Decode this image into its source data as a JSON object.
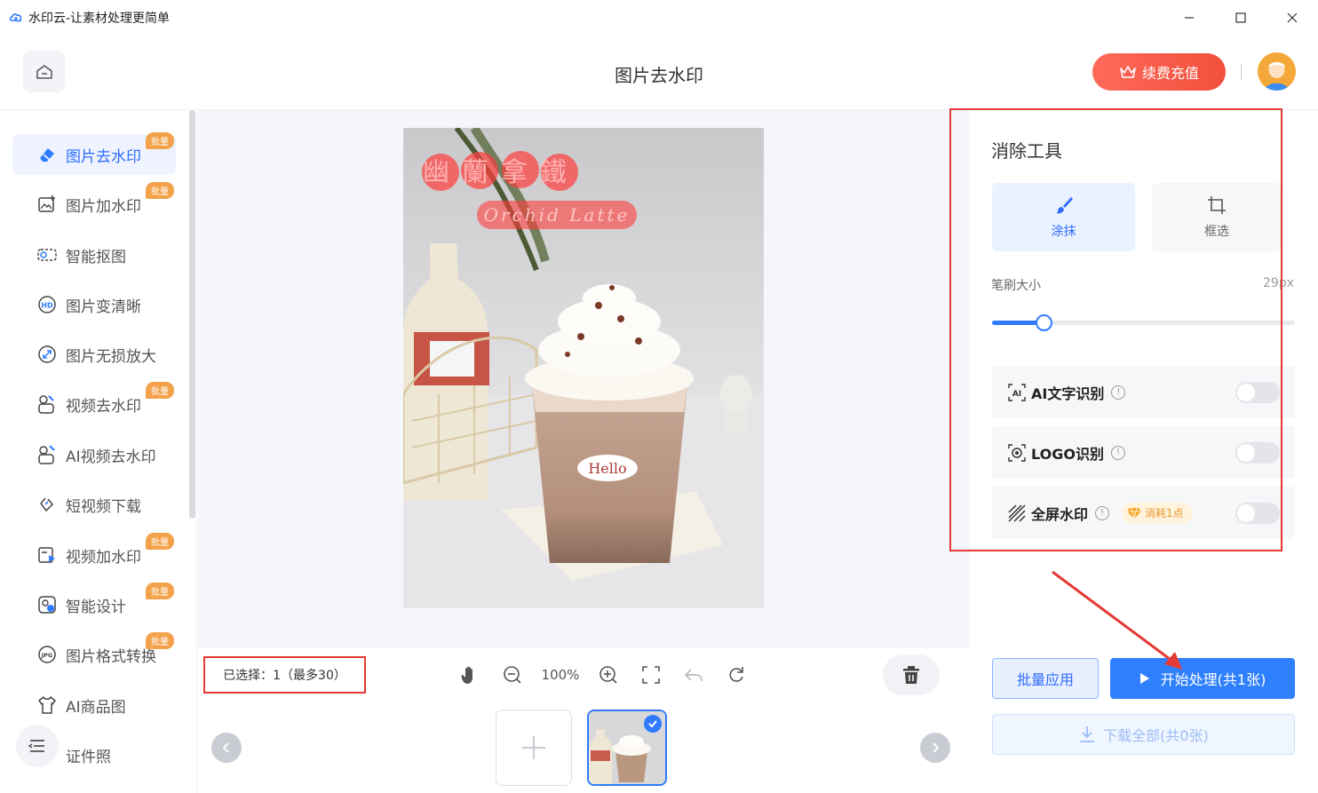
{
  "window": {
    "title": "水印云-让素材处理更简单"
  },
  "header": {
    "page_title": "图片去水印",
    "recharge_label": "续费充值"
  },
  "sidebar": {
    "items": [
      {
        "label": "图片去水印",
        "badge": "批量",
        "icon": "eraser-icon",
        "active": true
      },
      {
        "label": "图片加水印",
        "badge": "批量",
        "icon": "image-add-icon"
      },
      {
        "label": "智能抠图",
        "badge": "",
        "icon": "cutout-icon"
      },
      {
        "label": "图片变清晰",
        "badge": "",
        "icon": "hd-icon"
      },
      {
        "label": "图片无损放大",
        "badge": "",
        "icon": "enlarge-icon"
      },
      {
        "label": "视频去水印",
        "badge": "批量",
        "icon": "video-eraser-icon"
      },
      {
        "label": "AI视频去水印",
        "badge": "",
        "icon": "ai-video-icon"
      },
      {
        "label": "短视频下载",
        "badge": "",
        "icon": "link-icon"
      },
      {
        "label": "视频加水印",
        "badge": "批量",
        "icon": "video-add-icon"
      },
      {
        "label": "智能设计",
        "badge": "批量",
        "icon": "design-icon"
      },
      {
        "label": "图片格式转换",
        "badge": "批量",
        "icon": "jpg-icon"
      },
      {
        "label": "AI商品图",
        "badge": "",
        "icon": "shirt-icon"
      },
      {
        "label": "证件照",
        "badge": "",
        "icon": "id-photo-icon"
      }
    ]
  },
  "canvas": {
    "photo": {
      "watermark_line1": "幽蘭拿鐵",
      "watermark_line2": "Orchid Latte",
      "cup_text": "Hello"
    }
  },
  "bottombar": {
    "selected_info": "已选择：1（最多30）",
    "zoom": "100%"
  },
  "panel": {
    "title": "消除工具",
    "mode_brush": "涂抹",
    "mode_box": "框选",
    "brush_size_label": "笔刷大小",
    "brush_size_value": "29px",
    "brush_fraction": 0.17,
    "options": [
      {
        "label": "AI文字识别",
        "icon": "ai-text-icon",
        "enabled": false
      },
      {
        "label": "LOGO识别",
        "icon": "logo-detect-icon",
        "enabled": false
      },
      {
        "label": "全屏水印",
        "icon": "fullscreen-watermark-icon",
        "enabled": false,
        "cost": "消耗1点"
      }
    ],
    "batch_apply": "批量应用",
    "start_process": "开始处理(共1张)",
    "download_all": "下载全部(共0张)"
  },
  "colors": {
    "accent": "#2f80ff",
    "recharge": "#f24f3c",
    "highlight": "#e53935",
    "badge": "#f3a24b"
  }
}
